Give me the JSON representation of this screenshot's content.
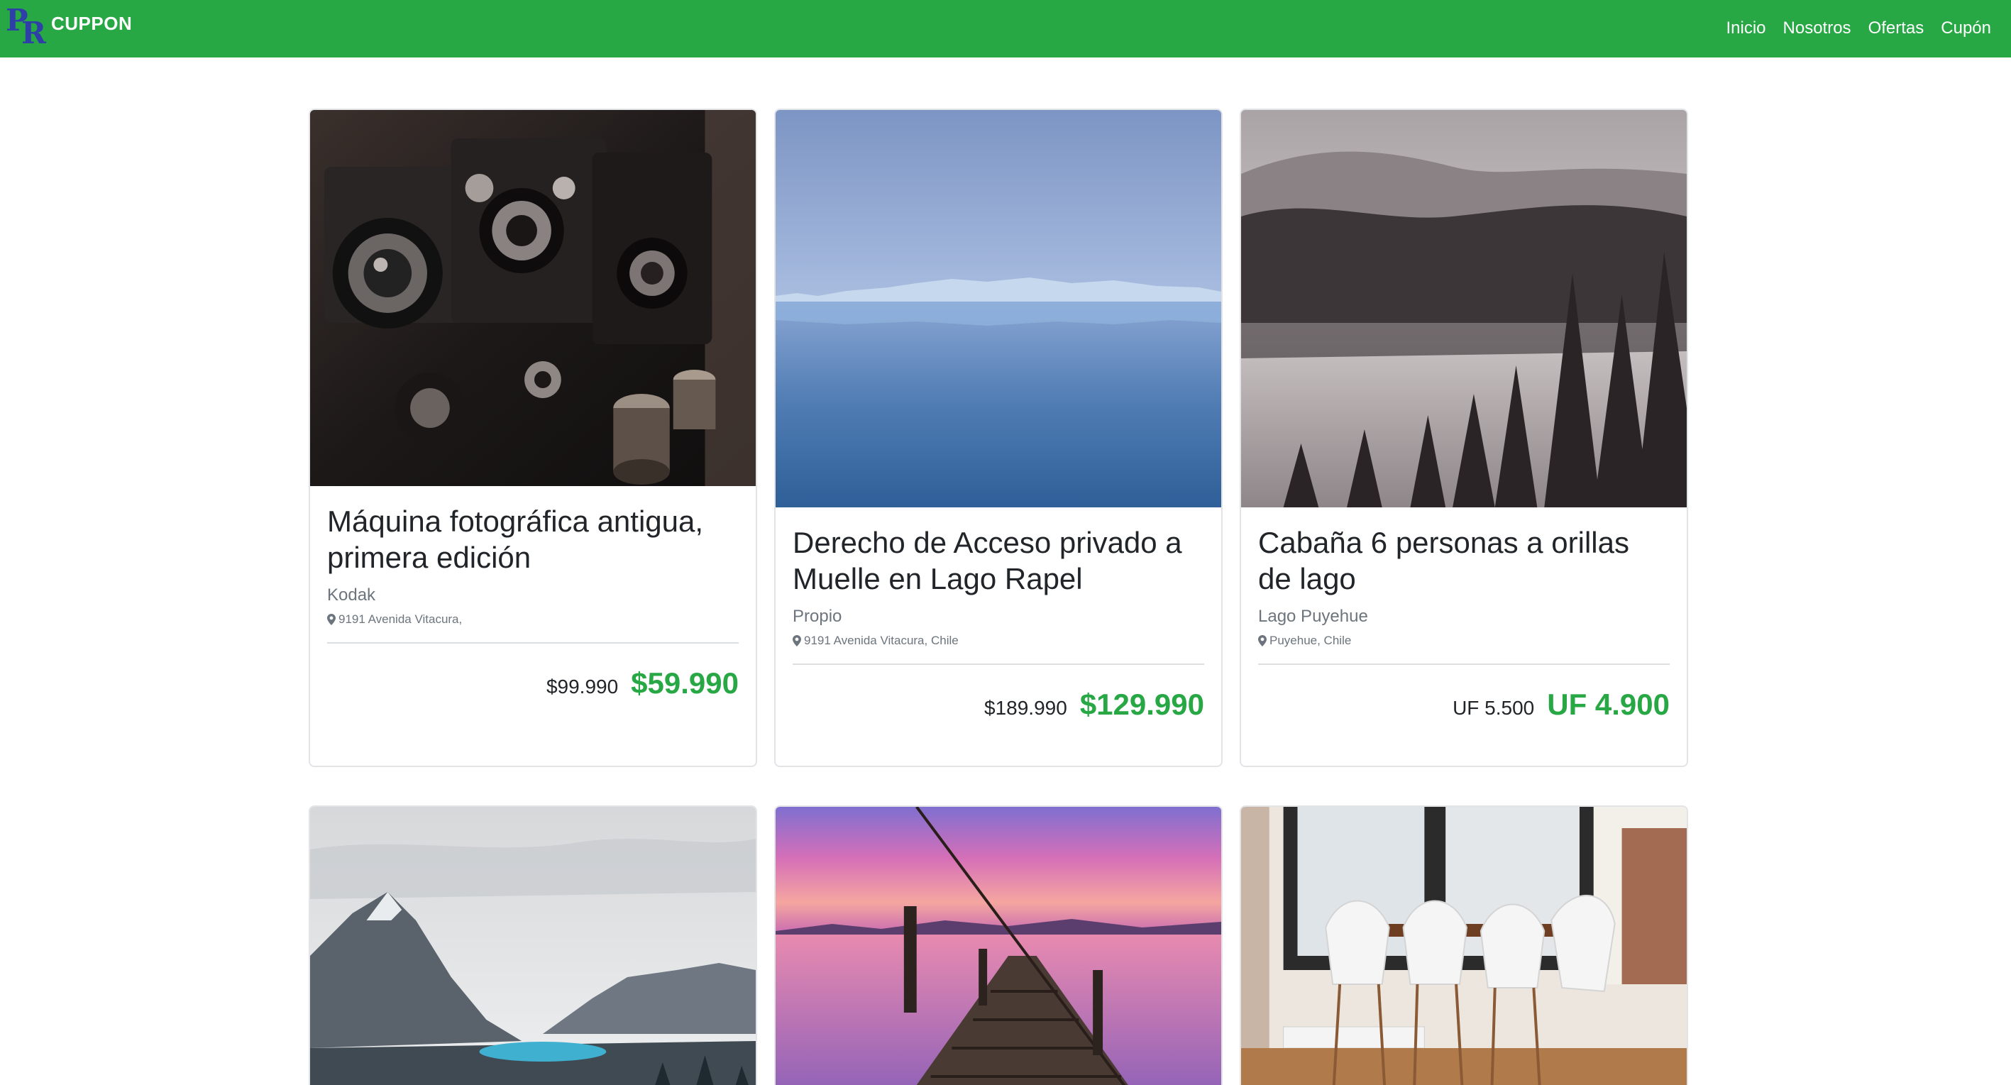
{
  "brand": {
    "logo_letters": "PR",
    "name": "CUPPON"
  },
  "nav": {
    "items": [
      {
        "label": "Inicio"
      },
      {
        "label": "Nosotros"
      },
      {
        "label": "Ofertas"
      },
      {
        "label": "Cupón"
      }
    ]
  },
  "colors": {
    "accent": "#28a745",
    "logo": "#2f3fa8"
  },
  "cards": [
    {
      "image": "antique-cameras-photo",
      "title": "Máquina fotográfica antigua, primera edición",
      "vendor": "Kodak",
      "location": "9191 Avenida Vitacura,",
      "old_price": "$99.990",
      "new_price": "$59.990"
    },
    {
      "image": "glacier-lake-photo",
      "title": "Derecho de Acceso privado a Muelle en Lago Rapel",
      "vendor": "Propio",
      "location": "9191 Avenida Vitacura, Chile",
      "old_price": "$189.990",
      "new_price": "$129.990"
    },
    {
      "image": "forest-lake-photo",
      "title": "Cabaña 6 personas a orillas de lago",
      "vendor": "Lago Puyehue",
      "location": "Puyehue, Chile",
      "old_price": "UF 5.500",
      "new_price": "UF 4.900"
    },
    {
      "image": "mountain-lake-photo"
    },
    {
      "image": "sunset-pier-photo"
    },
    {
      "image": "dining-room-photo"
    }
  ]
}
